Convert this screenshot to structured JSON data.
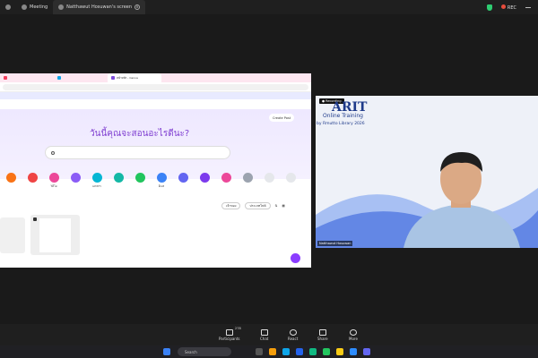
{
  "zoom_tabs": [
    {
      "label": ""
    },
    {
      "label": "Meeting"
    },
    {
      "label": "Natthawut Hosuwan's screen"
    }
  ],
  "zoom_status": {
    "rec": "REC"
  },
  "browser": {
    "tab1": "",
    "tab2": "",
    "tab3": "หน้าหลัก - Canva",
    "promo_text": "",
    "promo_link": "",
    "hero_title": "วันนี้คุณจะสอนอะไรดีนะ?",
    "search_placeholder": "",
    "create_label": "Create Post",
    "filter1": "เจ้าของ",
    "filter2": "ประเภทไฟล์",
    "card_badge": "",
    "card_title": "",
    "card_sub": ""
  },
  "categories": [
    {
      "label": "",
      "color": "#f97316"
    },
    {
      "label": "",
      "color": "#ef4444"
    },
    {
      "label": "วิดีโอ",
      "color": "#ec4899"
    },
    {
      "label": "",
      "color": "#8b5cf6"
    },
    {
      "label": "เอกสาร",
      "color": "#06b6d4"
    },
    {
      "label": "",
      "color": "#14b8a6"
    },
    {
      "label": "",
      "color": "#22c55e"
    },
    {
      "label": "อีเมล",
      "color": "#3b82f6"
    },
    {
      "label": "",
      "color": "#6366f1"
    },
    {
      "label": "",
      "color": "#7c3aed"
    },
    {
      "label": "",
      "color": "#ec4899"
    },
    {
      "label": "",
      "color": "#9ca3af"
    },
    {
      "label": "",
      "color": "#e5e7eb"
    },
    {
      "label": "",
      "color": "#e5e7eb"
    }
  ],
  "video": {
    "rec_label": "Recording",
    "logo": "ARIT",
    "title": "Online Training",
    "subtitle": "by Rmutto Library 2026",
    "name": "Natthawut Hosuwan"
  },
  "toolbar": [
    {
      "label": "Participants",
      "count": "278"
    },
    {
      "label": "Chat",
      "count": ""
    },
    {
      "label": "React",
      "count": ""
    },
    {
      "label": "Share",
      "count": ""
    },
    {
      "label": "More",
      "count": ""
    }
  ],
  "taskbar": {
    "search": "Search"
  }
}
